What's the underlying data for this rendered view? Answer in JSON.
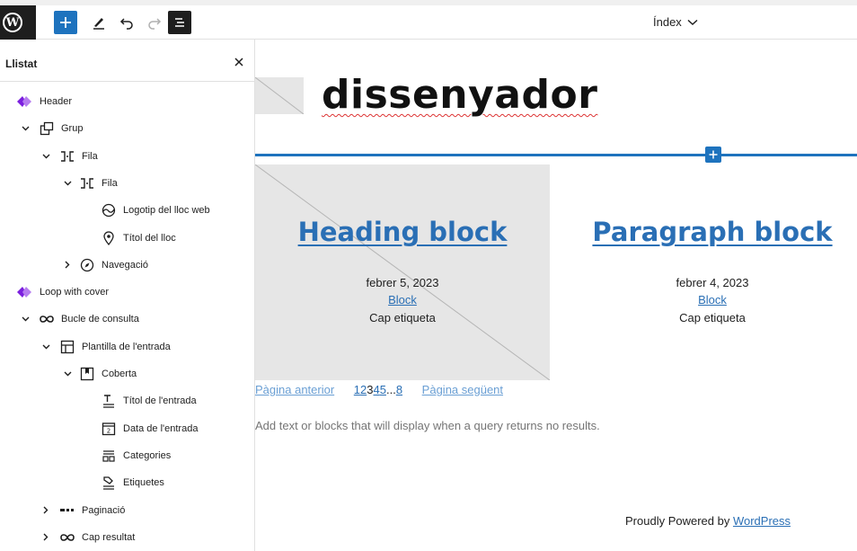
{
  "toolbar": {
    "logo_glyph": "W",
    "document_title": "Índex",
    "icons": [
      "wordpress-icon",
      "plus-icon",
      "pencil-icon",
      "undo-icon",
      "redo-icon",
      "list-view-icon",
      "chevron-down-icon"
    ]
  },
  "sidebar": {
    "title": "Llistat",
    "close_icon": "close-icon",
    "items": [
      {
        "label": "Header",
        "icon": "pattern-diamond-icon",
        "depth": 0,
        "expander": "none"
      },
      {
        "label": "Grup",
        "icon": "group-icon",
        "depth": 1,
        "expander": "expanded"
      },
      {
        "label": "Fila",
        "icon": "row-icon",
        "depth": 2,
        "expander": "expanded"
      },
      {
        "label": "Fila",
        "icon": "row-icon",
        "depth": 3,
        "expander": "expanded"
      },
      {
        "label": "Logotip del lloc web",
        "icon": "site-logo-icon",
        "depth": 4,
        "expander": "none"
      },
      {
        "label": "Títol del lloc",
        "icon": "map-marker-icon",
        "depth": 4,
        "expander": "none"
      },
      {
        "label": "Navegació",
        "icon": "compass-icon",
        "depth": 3,
        "expander": "collapsed"
      },
      {
        "label": "Loop with cover",
        "icon": "pattern-diamond-icon",
        "depth": 0,
        "expander": "none"
      },
      {
        "label": "Bucle de consulta",
        "icon": "loop-icon",
        "depth": 1,
        "expander": "expanded"
      },
      {
        "label": "Plantilla de l'entrada",
        "icon": "layout-icon",
        "depth": 2,
        "expander": "expanded"
      },
      {
        "label": "Coberta",
        "icon": "cover-icon",
        "depth": 3,
        "expander": "expanded"
      },
      {
        "label": "Títol de l'entrada",
        "icon": "post-title-icon",
        "depth": 4,
        "expander": "none"
      },
      {
        "label": "Data de l'entrada",
        "icon": "post-date-icon",
        "depth": 4,
        "expander": "none"
      },
      {
        "label": "Categories",
        "icon": "categories-icon",
        "depth": 4,
        "expander": "none"
      },
      {
        "label": "Etiquetes",
        "icon": "tags-icon",
        "depth": 4,
        "expander": "none"
      },
      {
        "label": "Paginació",
        "icon": "pagination-icon",
        "depth": 2,
        "expander": "collapsed"
      },
      {
        "label": "Cap resultat",
        "icon": "loop-icon",
        "depth": 2,
        "expander": "collapsed"
      }
    ]
  },
  "canvas": {
    "site_title": "dissenyador",
    "posts": [
      {
        "title": "Heading block",
        "date": "febrer 5, 2023",
        "category": "Block",
        "tags": "Cap etiqueta"
      },
      {
        "title": "Paragraph block",
        "date": "febrer 4, 2023",
        "category": "Block",
        "tags": "Cap etiqueta"
      }
    ],
    "pagination": {
      "previous": "Pàgina anterior",
      "pages": [
        "1",
        "2",
        "3",
        "4",
        "5"
      ],
      "current": "3",
      "ellipsis": "...",
      "last": "8",
      "next": "Pàgina següent"
    },
    "no_results": "Add text or blocks that will display when a query returns no results.",
    "footer": {
      "prefix": "Proudly Powered by ",
      "link": "WordPress"
    }
  },
  "colors": {
    "accent": "#1e73be",
    "link": "#2a6fb5",
    "pattern": "#7b1fde",
    "placeholder": "#e6e6e6"
  }
}
